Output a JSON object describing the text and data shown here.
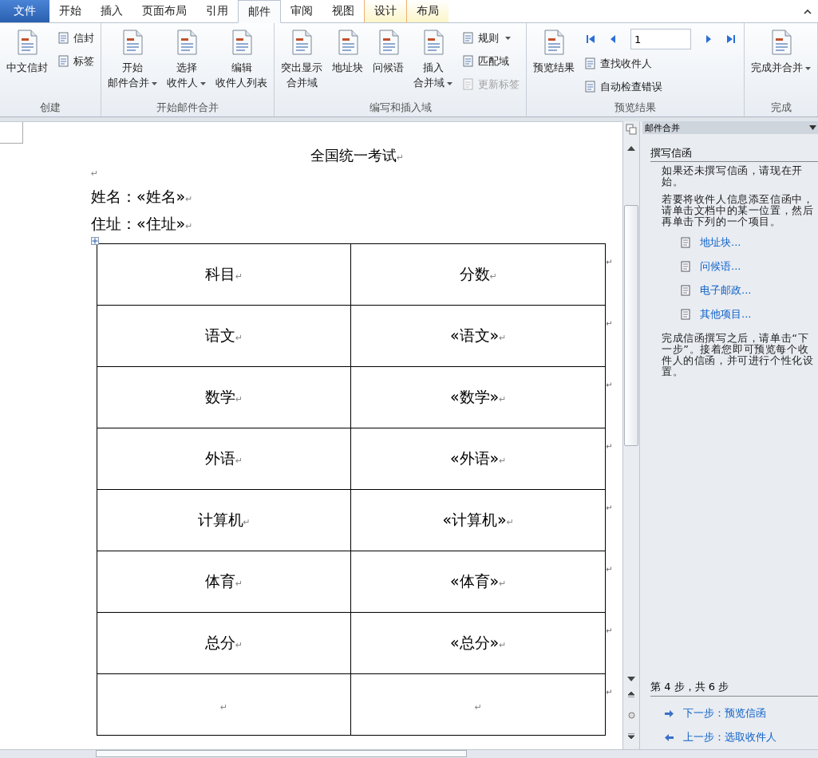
{
  "tabs": [
    {
      "label": "文件",
      "kind": "file",
      "selected": false
    },
    {
      "label": "开始",
      "kind": "normal",
      "selected": false
    },
    {
      "label": "插入",
      "kind": "normal",
      "selected": false
    },
    {
      "label": "页面布局",
      "kind": "normal",
      "selected": false
    },
    {
      "label": "引用",
      "kind": "normal",
      "selected": false
    },
    {
      "label": "邮件",
      "kind": "normal",
      "selected": true
    },
    {
      "label": "审阅",
      "kind": "normal",
      "selected": false
    },
    {
      "label": "视图",
      "kind": "normal",
      "selected": false
    },
    {
      "label": "设计",
      "kind": "contextual",
      "selected": false
    },
    {
      "label": "布局",
      "kind": "contextual",
      "selected": false
    }
  ],
  "ribbon": {
    "groups": [
      {
        "label": "创建",
        "items": [
          {
            "kind": "large",
            "lines": [
              "中文信封"
            ],
            "dropdown": false,
            "disabled": false
          },
          {
            "kind": "small",
            "lines": [
              "信封"
            ],
            "dropdown": false,
            "disabled": false
          },
          {
            "kind": "small",
            "lines": [
              "标签"
            ],
            "dropdown": false,
            "disabled": false
          }
        ]
      },
      {
        "label": "开始邮件合并",
        "items": [
          {
            "kind": "large",
            "lines": [
              "开始",
              "邮件合并"
            ],
            "dropdown": true,
            "disabled": false
          },
          {
            "kind": "large",
            "lines": [
              "选择",
              "收件人"
            ],
            "dropdown": true,
            "disabled": false
          },
          {
            "kind": "large",
            "lines": [
              "编辑",
              "收件人列表"
            ],
            "dropdown": false,
            "disabled": false
          }
        ]
      },
      {
        "label": "编写和插入域",
        "items": [
          {
            "kind": "large",
            "lines": [
              "突出显示",
              "合并域"
            ],
            "dropdown": false,
            "disabled": false
          },
          {
            "kind": "large",
            "lines": [
              "地址块"
            ],
            "dropdown": false,
            "disabled": false
          },
          {
            "kind": "large",
            "lines": [
              "问候语"
            ],
            "dropdown": false,
            "disabled": false
          },
          {
            "kind": "large",
            "lines": [
              "插入",
              "合并域"
            ],
            "dropdown": true,
            "disabled": false
          },
          {
            "kind": "small",
            "lines": [
              "规则"
            ],
            "dropdown": true,
            "disabled": false
          },
          {
            "kind": "small",
            "lines": [
              "匹配域"
            ],
            "dropdown": false,
            "disabled": false
          },
          {
            "kind": "small",
            "lines": [
              "更新标签"
            ],
            "dropdown": false,
            "disabled": true
          }
        ]
      },
      {
        "label": "预览结果",
        "items": [
          {
            "kind": "large",
            "lines": [
              "预览结果"
            ],
            "dropdown": false,
            "disabled": false
          },
          {
            "kind": "nav",
            "value": "1"
          },
          {
            "kind": "small",
            "lines": [
              "查找收件人"
            ],
            "dropdown": false,
            "disabled": false
          },
          {
            "kind": "small",
            "lines": [
              "自动检查错误"
            ],
            "dropdown": false,
            "disabled": false
          }
        ]
      },
      {
        "label": "完成",
        "items": [
          {
            "kind": "large",
            "lines": [
              "完成并合并"
            ],
            "dropdown": true,
            "disabled": false
          }
        ]
      }
    ]
  },
  "document": {
    "title": {
      "text": "全国统一考试",
      "mark": "↵"
    },
    "blank_line": {
      "mark": "↵"
    },
    "lines": [
      {
        "text": "姓名：«姓名»",
        "mark": "↵"
      },
      {
        "text": "住址：«住址»",
        "mark": "↵"
      }
    ],
    "table": {
      "rows": [
        {
          "cells": [
            {
              "text": "科目",
              "mark": "↵"
            },
            {
              "text": "分数",
              "mark": "↵"
            }
          ],
          "end_mark": "↵"
        },
        {
          "cells": [
            {
              "text": "语文",
              "mark": "↵"
            },
            {
              "text": "«语文»",
              "mark": "↵"
            }
          ],
          "end_mark": "↵"
        },
        {
          "cells": [
            {
              "text": "数学",
              "mark": "↵"
            },
            {
              "text": "«数学»",
              "mark": "↵"
            }
          ],
          "end_mark": "↵"
        },
        {
          "cells": [
            {
              "text": "外语",
              "mark": "↵"
            },
            {
              "text": "«外语»",
              "mark": "↵"
            }
          ],
          "end_mark": "↵"
        },
        {
          "cells": [
            {
              "text": "计算机",
              "mark": "↵"
            },
            {
              "text": "«计算机»",
              "mark": "↵"
            }
          ],
          "end_mark": "↵"
        },
        {
          "cells": [
            {
              "text": "体育",
              "mark": "↵"
            },
            {
              "text": "«体育»",
              "mark": "↵"
            }
          ],
          "end_mark": "↵"
        },
        {
          "cells": [
            {
              "text": "总分",
              "mark": "↵"
            },
            {
              "text": "«总分»",
              "mark": "↵"
            }
          ],
          "end_mark": "↵"
        },
        {
          "cells": [
            {
              "text": "",
              "mark": "↵"
            },
            {
              "text": "",
              "mark": "↵"
            }
          ],
          "end_mark": "↵"
        }
      ]
    }
  },
  "task_pane": {
    "title": "邮件合并",
    "heading": "撰写信函",
    "paragraphs": [
      "如果还未撰写信函，请现在开始。",
      "若要将收件人信息添至信函中，请单击文档中的某一位置，然后再单击下列的一个项目。"
    ],
    "links": [
      {
        "label": "地址块..."
      },
      {
        "label": "问候语..."
      },
      {
        "label": "电子邮政..."
      },
      {
        "label": "其他项目..."
      }
    ],
    "closing": "完成信函撰写之后，请单击“下一步”。接着您即可预览每个收件人的信函，并可进行个性化设置。",
    "step": "第 4 步，共 6 步",
    "next": "下一步：预览信函",
    "previous": "上一步：选取收件人"
  }
}
